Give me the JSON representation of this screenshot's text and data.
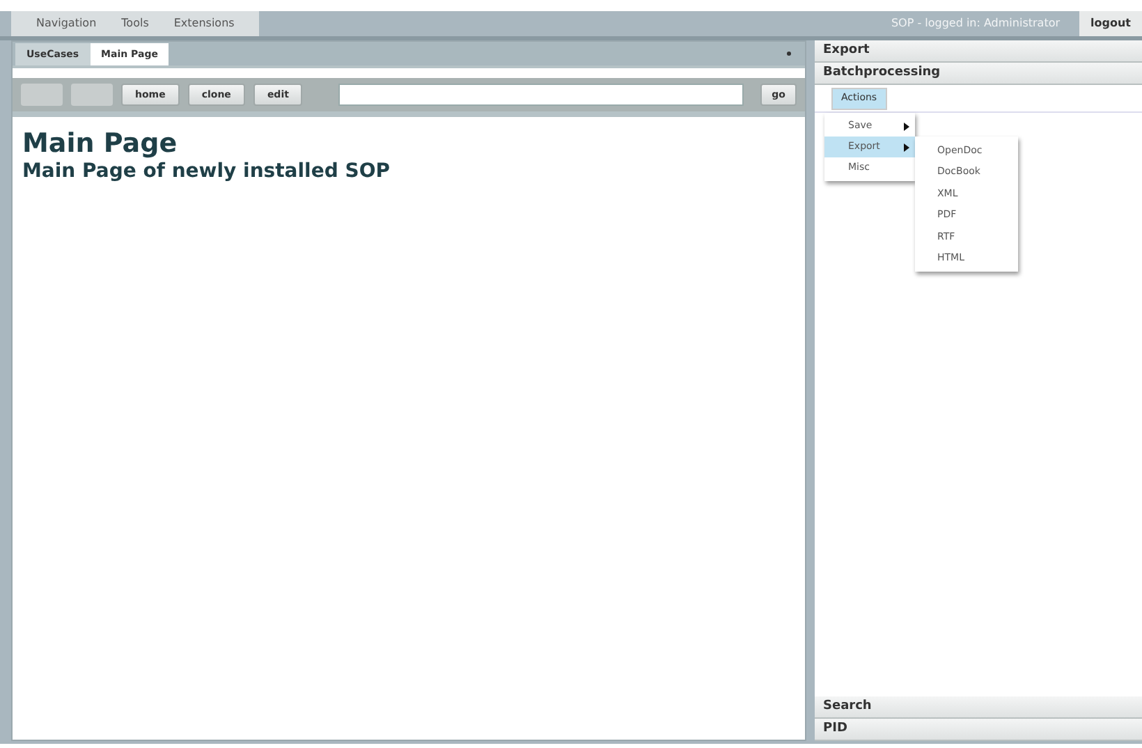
{
  "menu_bar": {
    "items": [
      "Navigation",
      "Tools",
      "Extensions"
    ],
    "status": "SOP - logged in: Administrator",
    "logout": "logout"
  },
  "tabs": [
    {
      "label": "UseCases",
      "selected": false
    },
    {
      "label": "Main Page",
      "selected": true
    }
  ],
  "toolbar": {
    "buttons": [
      {
        "disabled": true
      },
      {
        "disabled": true
      },
      {
        "label": "home",
        "disabled": false
      },
      {
        "label": "clone",
        "disabled": false
      },
      {
        "label": "edit",
        "disabled": false
      }
    ],
    "go": "go"
  },
  "content": {
    "title": "Main Page",
    "subtitle": "Main Page of newly installed SOP"
  },
  "right_panel": {
    "top_sections": [
      "Export",
      "Batchprocessing"
    ],
    "actions_button": "Actions",
    "menu": [
      {
        "label": "Save",
        "has_submenu": true,
        "selected": false
      },
      {
        "label": "Export",
        "has_submenu": true,
        "selected": true,
        "children": [
          "OpenDoc",
          "DocBook",
          "XML",
          "PDF",
          "RTF",
          "HTML"
        ]
      },
      {
        "label": "Misc",
        "has_submenu": false,
        "selected": false
      }
    ],
    "bottom_sections": [
      "Search",
      "PID"
    ]
  }
}
